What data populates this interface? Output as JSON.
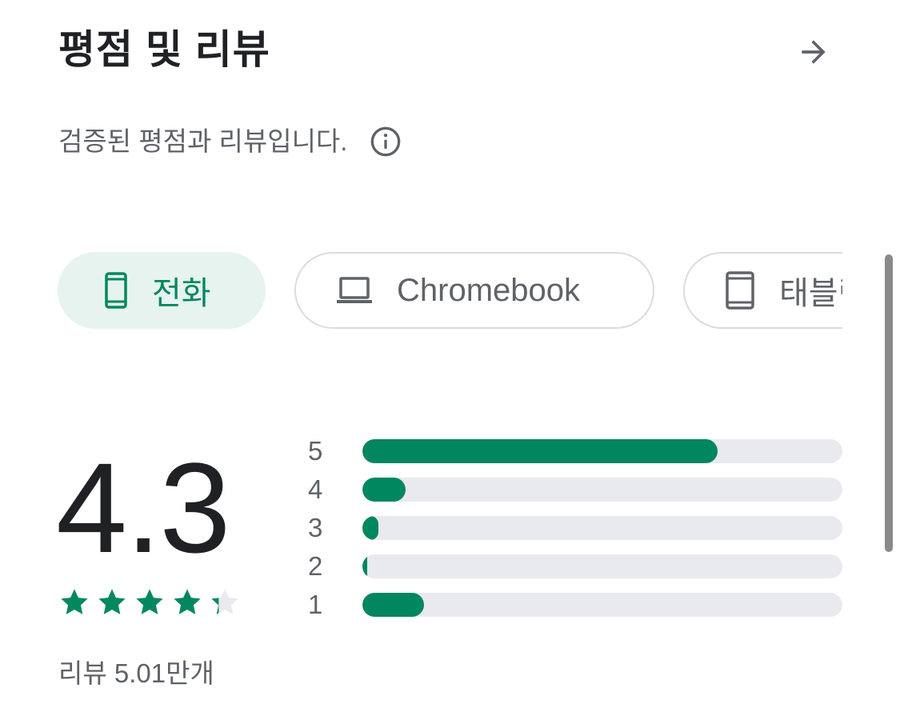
{
  "header": {
    "title": "평점 및 리뷰"
  },
  "subtitle": "검증된 평점과 리뷰입니다.",
  "icons": {
    "arrow": "arrow-right-icon",
    "info": "info-icon",
    "phone": "phone-icon",
    "laptop": "laptop-icon",
    "tablet": "tablet-icon",
    "star": "star-icon"
  },
  "device_tabs": [
    {
      "label": "전화",
      "selected": true
    },
    {
      "label": "Chromebook",
      "selected": false
    },
    {
      "label": "태블릿",
      "selected": false
    }
  ],
  "rating": {
    "value": "4.3",
    "stars": 4.3,
    "review_count": "리뷰 5.01만개"
  },
  "distribution": [
    {
      "label": "5",
      "fraction": 0.74
    },
    {
      "label": "4",
      "fraction": 0.09
    },
    {
      "label": "3",
      "fraction": 0.033
    },
    {
      "label": "2",
      "fraction": 0.01
    },
    {
      "label": "1",
      "fraction": 0.128
    }
  ],
  "colors": {
    "accent": "#01875f",
    "chip_selected_bg": "#e6f3ef",
    "track": "#e8eaed",
    "text_primary": "#202124",
    "text_secondary": "#5f6368"
  }
}
